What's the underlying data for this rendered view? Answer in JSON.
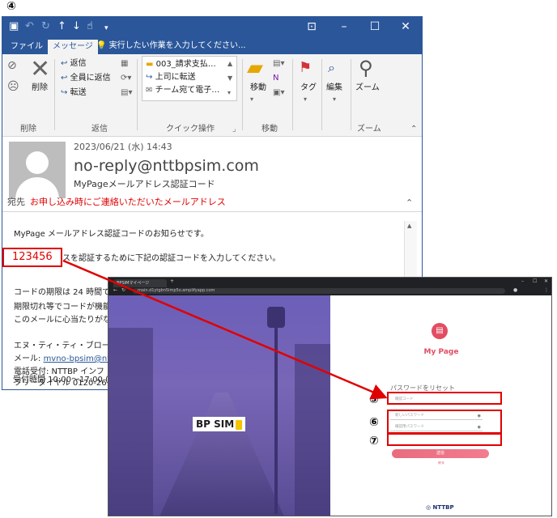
{
  "steps": {
    "s4": "④",
    "s5": "⑤",
    "s6": "⑥",
    "s7": "⑦"
  },
  "outlook": {
    "tabs": {
      "file": "ファイル",
      "message": "メッセージ"
    },
    "tell_me": "実行したい作業を入力してください...",
    "ribbon": {
      "delete": "削除",
      "reply": "返信",
      "reply_all": "全員に返信",
      "forward": "転送",
      "quick1": "003_請求支払…",
      "quick2": "上司に転送",
      "quick3": "チーム宛て電子…",
      "move": "移動",
      "tags": "タグ",
      "edit": "編集",
      "zoom": "ズーム",
      "groups": {
        "delete": "削除",
        "respond": "返信",
        "quick": "クイック操作",
        "move": "移動",
        "zoom": "ズーム"
      }
    },
    "message": {
      "date": "2023/06/21 (水) 14:43",
      "sender": "no-reply@nttbpsim.com",
      "subject": "MyPageメールアドレス認証コード",
      "to_label": "宛先",
      "to_note": "お申し込み時にご連絡いただいたメールアドレス",
      "line1": "MyPage メールアドレス認証コードのお知らせです。",
      "line2": "メールアドレスを認証するために下記の認証コードを入力してください。",
      "code": "123456",
      "line3": "コードの期限は 24 時間で",
      "line4": "期限切れ等でコードが機能",
      "line5": "このメールに心当たりがな",
      "sig1": "エヌ・ティ・ティ・ブロードバ",
      "sig2_label": "メール: ",
      "sig2_link": "mvno-bpsim@ntt-",
      "sig3": "電話受付: NTTBP インフ",
      "sig4": "フリーダイヤル 0120-2610",
      "sig5": "受付時間 10:00〜17:00 (土"
    }
  },
  "browser": {
    "tab_title": "BPSIMマイページ",
    "url": "main.d1ytgbn5imp5o.amplifyapp.com",
    "logo": "BP SIM",
    "mypage_title": "My Page",
    "reset_title": "パスワードをリセット",
    "code_placeholder": "確認コード",
    "new_password_placeholder": "新しいパスワード",
    "confirm_password_placeholder": "確認用パスワード",
    "send_button": "送信",
    "back_link": "戻る",
    "footer_logo": "NTTBP"
  },
  "colors": {
    "accent": "#2b579a",
    "highlight": "#e00000",
    "mypage": "#e24d64"
  }
}
